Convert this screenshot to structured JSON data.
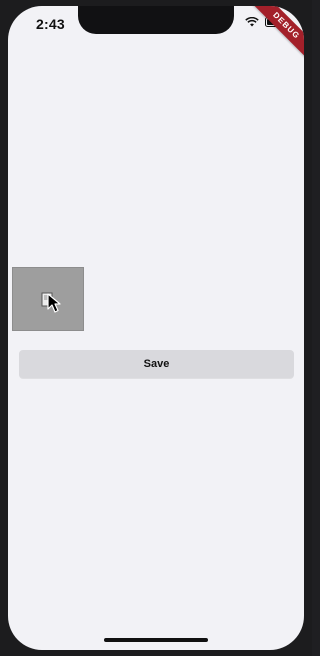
{
  "status_bar": {
    "time": "2:43",
    "wifi_icon": "wifi-icon",
    "battery_icon": "battery-icon"
  },
  "debug_banner": {
    "label": "DEBUG",
    "color": "#a3202a"
  },
  "image_placeholder": {
    "icon": "broken-image-icon",
    "cursor": "cursor-icon"
  },
  "actions": {
    "save_label": "Save"
  },
  "colors": {
    "screen_background": "#f2f2f6",
    "button_background": "#d9d9dd",
    "placeholder_background": "#9e9e9e"
  }
}
